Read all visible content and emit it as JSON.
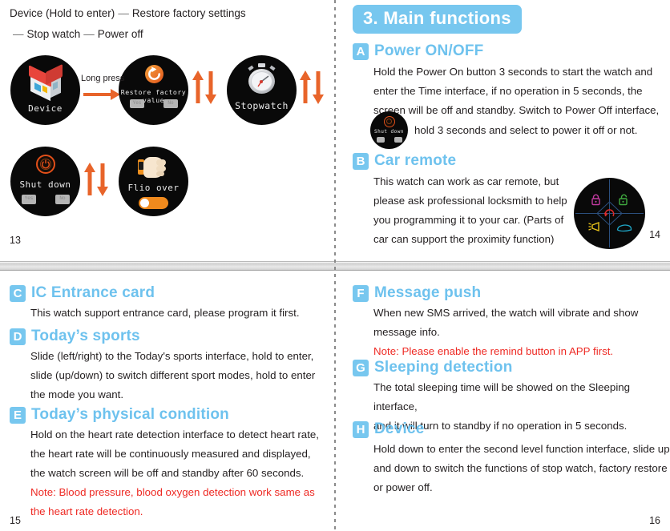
{
  "document": {
    "title": "Smart watch user manual pages 13-16"
  },
  "pages": {
    "p13": {
      "number": "13",
      "header": {
        "line1_label": "Device (Hold to enter)",
        "line1_dash": "—",
        "line1_item": "Restore factory settings",
        "line2_dash1": "—",
        "line2_item1": "Stop watch",
        "line2_dash2": "—",
        "line2_item2": "Power off"
      },
      "long_press_label": "Long press",
      "watches": [
        {
          "id": "device",
          "label": "Device"
        },
        {
          "id": "restore",
          "label": "Restore factory value",
          "yes": "Yes",
          "no": "No"
        },
        {
          "id": "stopwatch",
          "label": "Stopwatch"
        },
        {
          "id": "shutdown",
          "label": "Shut down",
          "yes": "Yes",
          "no": "No"
        },
        {
          "id": "flipover",
          "label": "Flio over"
        }
      ]
    },
    "p14": {
      "number": "14",
      "section_title": "3. Main functions",
      "items": [
        {
          "badge": "A",
          "title": "Power ON/OFF",
          "lines": [
            "Hold the Power On button 3 seconds to start the watch and",
            "enter the Time interface, if no operation in 5 seconds, the",
            "screen will be off and standby. Switch to Power Off interface,"
          ],
          "inline_watch_label": "Shut down",
          "after_watch_text": "hold 3 seconds and select to power it off or not."
        },
        {
          "badge": "B",
          "title": "Car remote",
          "lines": [
            "This watch can work as car remote, but",
            "please ask professional locksmith to help",
            "you programming it to your car. (Parts of",
            "car can support the proximity function)"
          ]
        }
      ]
    },
    "p15": {
      "number": "15",
      "items": [
        {
          "badge": "C",
          "title": "IC Entrance card",
          "lines": [
            "This watch support entrance card, please program it first."
          ],
          "note": []
        },
        {
          "badge": "D",
          "title": "Today’s sports",
          "lines": [
            "Slide (left/right) to the Today's sports interface, hold to enter,",
            "slide (up/down) to switch different sport modes, hold to enter",
            "the mode you want."
          ],
          "note": []
        },
        {
          "badge": "E",
          "title": "Today’s physical condition",
          "lines": [
            "Hold on the heart rate detection interface to detect heart rate,",
            "the heart rate will be continuously measured and displayed,",
            "the watch screen will be off and standby after 60 seconds."
          ],
          "note": [
            "Note: Blood pressure, blood oxygen detection work same as",
            "the heart rate detection."
          ]
        }
      ]
    },
    "p16": {
      "number": "16",
      "items": [
        {
          "badge": "F",
          "title": "Message push",
          "lines": [
            "When new SMS arrived, the watch will vibrate and show",
            "message info."
          ],
          "note": [
            "Note: Please enable the remind button in APP first."
          ]
        },
        {
          "badge": "G",
          "title": "Sleeping detection",
          "lines": [
            "The total sleeping time will be showed on the Sleeping interface,",
            "and it will turn to standby if no operation in 5 seconds."
          ],
          "note": []
        },
        {
          "badge": "H",
          "title": "Device",
          "lines": [
            "Hold down to enter the second level function interface, slide up",
            "and down to switch the functions of stop watch, factory restore",
            "or power off."
          ],
          "note": []
        }
      ]
    }
  },
  "colors": {
    "accent_blue": "#77c7ef",
    "heading_blue": "#6ec2ee",
    "note_red": "#ee2a24",
    "arrow_orange": "#e8642a",
    "watch_black": "#090909"
  },
  "icons": {
    "device": "house-icon",
    "restore": "restore-circular-arrow-icon",
    "stopwatch": "stopwatch-icon",
    "shutdown": "power-icon",
    "flipover": "wrist-watch-hand-icon",
    "car_lock": "lock-closed-icon",
    "car_unlock": "lock-open-icon",
    "car_trunk": "car-trunk-icon",
    "car_horn": "horn-icon",
    "car_find": "circular-arrow-icon",
    "updown": "up-down-arrows-icon"
  }
}
